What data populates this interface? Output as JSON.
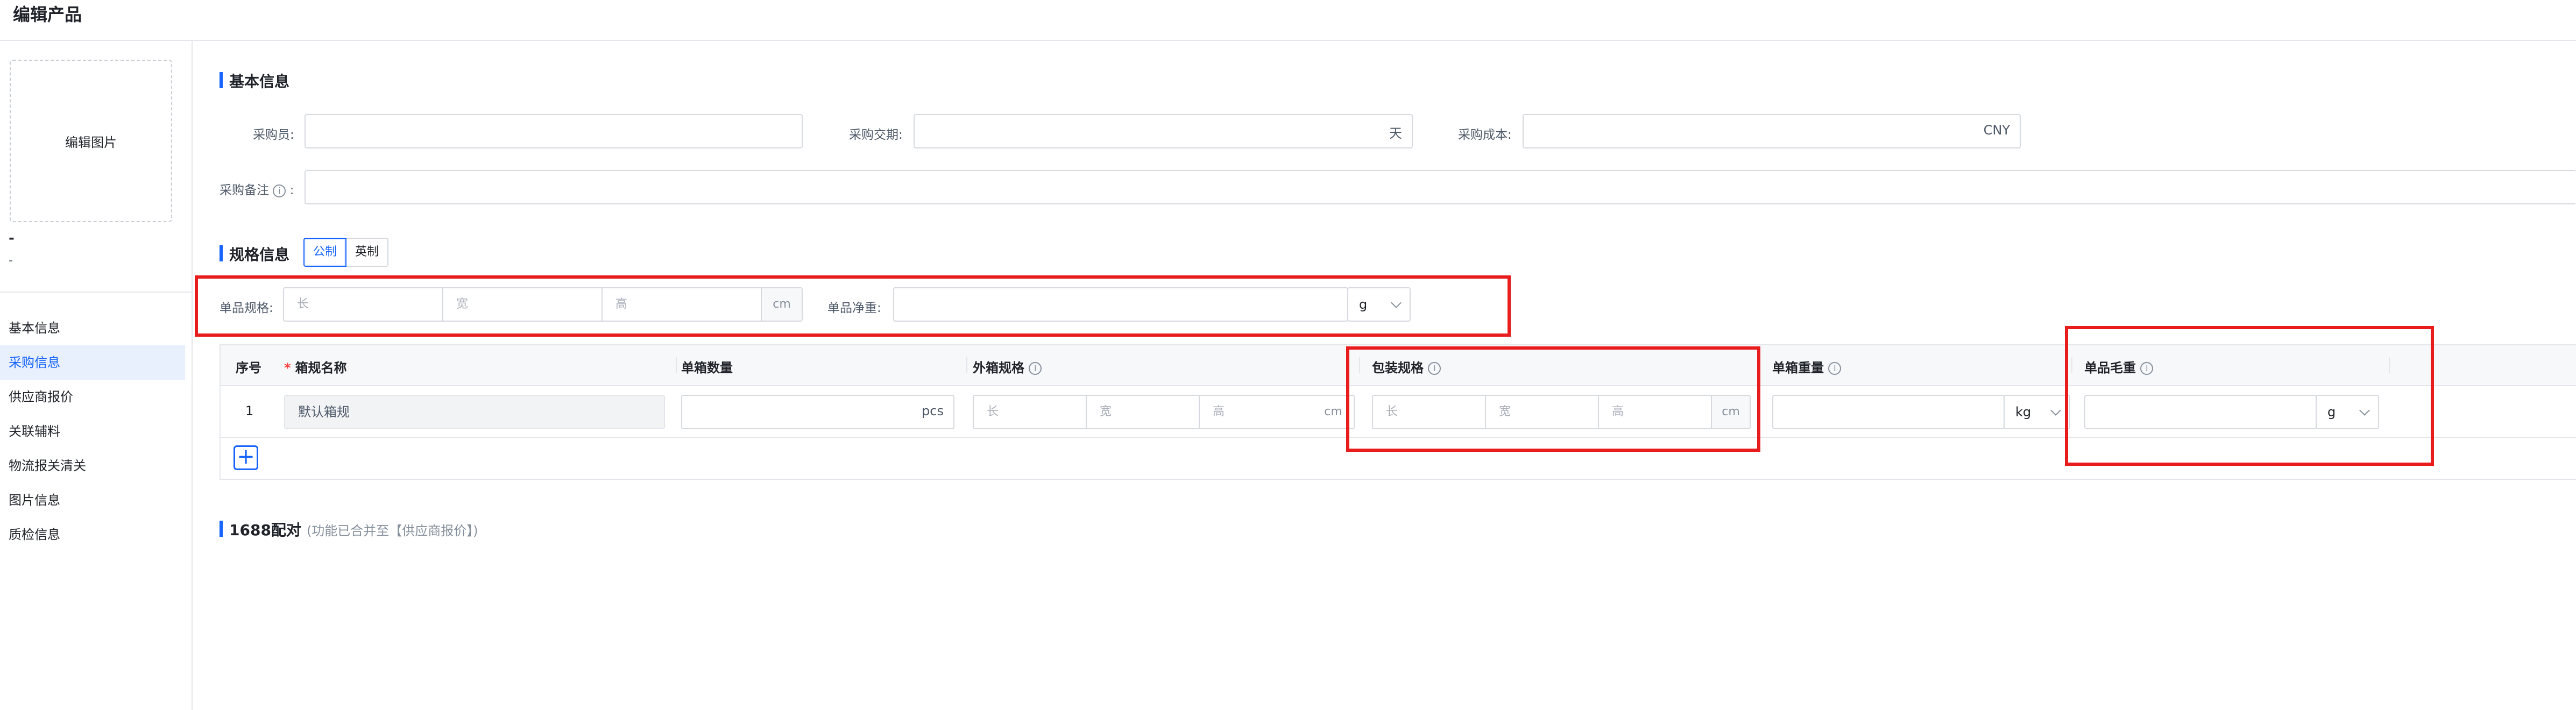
{
  "header": {
    "title": "编辑产品"
  },
  "sidebar": {
    "edit_image": "编辑图片",
    "name": "-",
    "code": "-",
    "items": [
      {
        "label": "基本信息"
      },
      {
        "label": "采购信息"
      },
      {
        "label": "供应商报价"
      },
      {
        "label": "关联辅料"
      },
      {
        "label": "物流报关清关"
      },
      {
        "label": "图片信息"
      },
      {
        "label": "质检信息"
      }
    ],
    "active_index": 1
  },
  "basic": {
    "title": "基本信息",
    "buyer_label": "采购员:",
    "buyer_value": "",
    "leadtime_label": "采购交期:",
    "leadtime_suffix": "天",
    "cost_label": "采购成本:",
    "cost_suffix": "CNY",
    "remark_label": "采购备注",
    "remark_colon": ":",
    "info_icon": "info-icon"
  },
  "spec": {
    "title": "规格信息",
    "unit_metric": "公制",
    "unit_imperial": "英制",
    "item_size_label": "单品规格:",
    "length_ph": "长",
    "width_ph": "宽",
    "height_ph": "高",
    "cm": "cm",
    "net_weight_label": "单品净重:",
    "weight_unit": "g"
  },
  "table": {
    "columns": [
      "序号",
      "箱规名称",
      "单箱数量",
      "外箱规格",
      "包装规格",
      "单箱重量",
      "单品毛重"
    ],
    "rows": [
      {
        "index": "1",
        "name": "默认箱规",
        "qty_suffix": "pcs",
        "box_weight_unit": "kg",
        "gross_unit": "g"
      }
    ],
    "add": "+"
  },
  "match": {
    "title": "1688配对",
    "note": "(功能已合并至【供应商报价】)"
  },
  "colors": {
    "accent": "#1664ff",
    "highlight": "#e81c1c"
  }
}
